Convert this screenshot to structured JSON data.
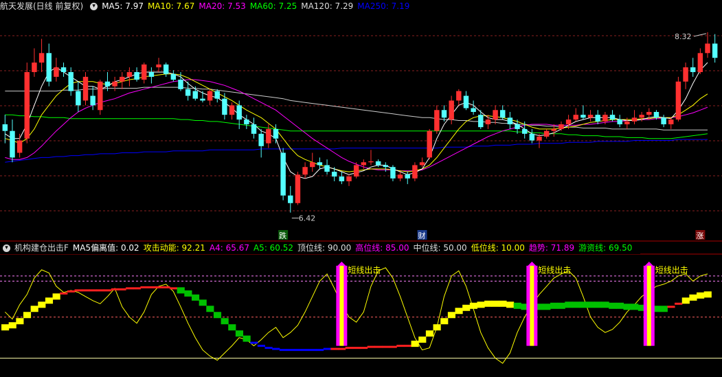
{
  "main_legend": {
    "title": "航天发展(日线 前复权)",
    "items": [
      {
        "label": "MA5: 7.97",
        "color": "#ffffff"
      },
      {
        "label": "MA10: 7.67",
        "color": "#ffff00"
      },
      {
        "label": "MA20: 7.53",
        "color": "#ff00ff"
      },
      {
        "label": "MA60: 7.25",
        "color": "#00ff00"
      },
      {
        "label": "MA120: 7.29",
        "color": "#dddddd"
      },
      {
        "label": "MA250: 7.19",
        "color": "#0000ff"
      }
    ]
  },
  "sub_legend": {
    "title": "机构建仓出击F",
    "items": [
      {
        "label": "MA5偏离值: 0.02",
        "color": "#ffffff"
      },
      {
        "label": "攻击动能: 92.21",
        "color": "#ffff00"
      },
      {
        "label": "A4: 65.67",
        "color": "#ff00ff"
      },
      {
        "label": "A5: 60.52",
        "color": "#00ff00"
      },
      {
        "label": "顶位线: 90.00",
        "color": "#dddddd"
      },
      {
        "label": "高位线: 85.00",
        "color": "#ff00ff"
      },
      {
        "label": "中位线: 50.00",
        "color": "#dddddd"
      },
      {
        "label": "低位线: 10.00",
        "color": "#ffff00"
      },
      {
        "label": "趋势: 71.89",
        "color": "#ff00ff"
      },
      {
        "label": "游资线: 69.50",
        "color": "#00ff00"
      }
    ]
  },
  "annotations": {
    "high_price": "8.32",
    "low_price": "6.42",
    "markers": [
      "跌",
      "财",
      "涨"
    ],
    "signal_label": "短线出击"
  },
  "colors": {
    "up": "#ff3030",
    "down": "#54ffff",
    "ma5": "#ffffff",
    "ma10": "#ffff00",
    "ma20": "#ff00ff",
    "ma60": "#00ff00",
    "ma120": "#cccccc",
    "ma250": "#0000ff",
    "grid": "#8a1f1f",
    "divider": "#aa0000"
  },
  "chart_data": {
    "type": "candlestick",
    "ylim": [
      6.2,
      8.5
    ],
    "candles": [
      [
        7.35,
        7.45,
        7.15,
        7.28
      ],
      [
        7.28,
        7.4,
        6.95,
        7.0
      ],
      [
        7.05,
        7.25,
        7.0,
        7.18
      ],
      [
        7.2,
        8.0,
        7.15,
        7.9
      ],
      [
        7.9,
        8.15,
        7.85,
        8.0
      ],
      [
        8.0,
        8.25,
        7.9,
        8.1
      ],
      [
        8.1,
        8.2,
        7.75,
        7.8
      ],
      [
        7.85,
        8.05,
        7.8,
        7.95
      ],
      [
        7.95,
        8.0,
        7.85,
        7.9
      ],
      [
        7.9,
        7.95,
        7.65,
        7.7
      ],
      [
        7.7,
        7.8,
        7.48,
        7.55
      ],
      [
        7.6,
        7.9,
        7.55,
        7.85
      ],
      [
        7.65,
        7.75,
        7.5,
        7.55
      ],
      [
        7.5,
        7.82,
        7.45,
        7.8
      ],
      [
        7.8,
        7.9,
        7.7,
        7.75
      ],
      [
        7.75,
        7.85,
        7.7,
        7.8
      ],
      [
        7.8,
        7.9,
        7.72,
        7.85
      ],
      [
        7.85,
        7.95,
        7.75,
        7.9
      ],
      [
        7.9,
        7.95,
        7.8,
        7.82
      ],
      [
        7.82,
        8.0,
        7.78,
        7.98
      ],
      [
        7.9,
        7.95,
        7.78,
        7.85
      ],
      [
        7.95,
        8.05,
        7.9,
        7.98
      ],
      [
        7.98,
        8.0,
        7.85,
        7.88
      ],
      [
        7.88,
        7.92,
        7.8,
        7.82
      ],
      [
        7.82,
        7.9,
        7.7,
        7.72
      ],
      [
        7.72,
        7.8,
        7.6,
        7.65
      ],
      [
        7.7,
        7.75,
        7.6,
        7.62
      ],
      [
        7.62,
        7.7,
        7.58,
        7.6
      ],
      [
        7.6,
        7.72,
        7.55,
        7.7
      ],
      [
        7.7,
        7.72,
        7.58,
        7.62
      ],
      [
        7.62,
        7.68,
        7.4,
        7.45
      ],
      [
        7.45,
        7.58,
        7.4,
        7.55
      ],
      [
        7.55,
        7.6,
        7.3,
        7.4
      ],
      [
        7.4,
        7.45,
        7.3,
        7.35
      ],
      [
        7.35,
        7.42,
        7.2,
        7.25
      ],
      [
        7.25,
        7.3,
        7.0,
        7.12
      ],
      [
        7.15,
        7.35,
        7.1,
        7.3
      ],
      [
        7.3,
        7.35,
        7.15,
        7.2
      ],
      [
        7.05,
        7.1,
        6.55,
        6.6
      ],
      [
        6.6,
        6.7,
        6.42,
        6.52
      ],
      [
        6.52,
        6.85,
        6.5,
        6.82
      ],
      [
        6.82,
        6.95,
        6.78,
        6.9
      ],
      [
        6.9,
        7.05,
        6.85,
        6.95
      ],
      [
        6.95,
        7.0,
        6.88,
        6.92
      ],
      [
        6.92,
        6.98,
        6.82,
        6.85
      ],
      [
        6.85,
        6.9,
        6.75,
        6.8
      ],
      [
        6.8,
        6.85,
        6.72,
        6.75
      ],
      [
        6.75,
        6.82,
        6.7,
        6.8
      ],
      [
        6.8,
        6.95,
        6.78,
        6.92
      ],
      [
        6.92,
        6.98,
        6.88,
        6.95
      ],
      [
        6.95,
        7.08,
        6.92,
        6.96
      ],
      [
        6.96,
        6.98,
        6.9,
        6.92
      ],
      [
        6.92,
        6.95,
        6.85,
        6.9
      ],
      [
        6.9,
        6.92,
        6.75,
        6.78
      ],
      [
        6.78,
        6.85,
        6.75,
        6.82
      ],
      [
        6.82,
        6.85,
        6.72,
        6.78
      ],
      [
        6.78,
        6.95,
        6.75,
        6.92
      ],
      [
        6.92,
        7.0,
        6.9,
        6.95
      ],
      [
        7.0,
        7.3,
        6.98,
        7.28
      ],
      [
        7.28,
        7.55,
        7.25,
        7.5
      ],
      [
        7.5,
        7.55,
        7.38,
        7.42
      ],
      [
        7.4,
        7.65,
        7.35,
        7.6
      ],
      [
        7.6,
        7.72,
        7.55,
        7.7
      ],
      [
        7.65,
        7.7,
        7.5,
        7.52
      ],
      [
        7.52,
        7.6,
        7.45,
        7.48
      ],
      [
        7.45,
        7.5,
        7.3,
        7.32
      ],
      [
        7.35,
        7.45,
        7.3,
        7.4
      ],
      [
        7.4,
        7.55,
        7.35,
        7.5
      ],
      [
        7.5,
        7.55,
        7.4,
        7.42
      ],
      [
        7.42,
        7.48,
        7.3,
        7.35
      ],
      [
        7.35,
        7.4,
        7.25,
        7.3
      ],
      [
        7.3,
        7.38,
        7.2,
        7.25
      ],
      [
        7.25,
        7.3,
        7.15,
        7.18
      ],
      [
        7.18,
        7.25,
        7.1,
        7.22
      ],
      [
        7.22,
        7.3,
        7.2,
        7.28
      ],
      [
        7.28,
        7.35,
        7.22,
        7.3
      ],
      [
        7.3,
        7.38,
        7.28,
        7.35
      ],
      [
        7.35,
        7.45,
        7.3,
        7.4
      ],
      [
        7.4,
        7.52,
        7.38,
        7.45
      ],
      [
        7.45,
        7.55,
        7.4,
        7.42
      ],
      [
        7.42,
        7.5,
        7.38,
        7.45
      ],
      [
        7.45,
        7.5,
        7.35,
        7.38
      ],
      [
        7.38,
        7.48,
        7.35,
        7.45
      ],
      [
        7.45,
        7.5,
        7.38,
        7.4
      ],
      [
        7.4,
        7.45,
        7.32,
        7.35
      ],
      [
        7.35,
        7.42,
        7.3,
        7.38
      ],
      [
        7.38,
        7.5,
        7.35,
        7.42
      ],
      [
        7.42,
        7.48,
        7.38,
        7.45
      ],
      [
        7.45,
        7.52,
        7.4,
        7.48
      ],
      [
        7.48,
        7.5,
        7.4,
        7.42
      ],
      [
        7.42,
        7.45,
        7.32,
        7.35
      ],
      [
        7.35,
        7.42,
        7.3,
        7.4
      ],
      [
        7.4,
        7.85,
        7.38,
        7.8
      ],
      [
        7.8,
        8.0,
        7.72,
        7.95
      ],
      [
        7.95,
        8.05,
        7.85,
        7.9
      ],
      [
        7.9,
        8.15,
        7.88,
        8.1
      ],
      [
        8.1,
        8.32,
        8.05,
        8.2
      ],
      [
        8.2,
        8.3,
        8.0,
        8.05
      ]
    ],
    "ma5": [
      7.25,
      7.2,
      7.2,
      7.35,
      7.55,
      7.75,
      7.9,
      7.95,
      7.9,
      7.85,
      7.8,
      7.75,
      7.75,
      7.72,
      7.75,
      7.8,
      7.82,
      7.85,
      7.88,
      7.9,
      7.9,
      7.9,
      7.9,
      7.88,
      7.85,
      7.78,
      7.72,
      7.68,
      7.65,
      7.63,
      7.58,
      7.52,
      7.45,
      7.4,
      7.35,
      7.28,
      7.25,
      7.2,
      7.0,
      6.85,
      6.8,
      6.78,
      6.8,
      6.88,
      6.9,
      6.88,
      6.85,
      6.82,
      6.84,
      6.86,
      6.9,
      6.92,
      6.92,
      6.88,
      6.85,
      6.82,
      6.84,
      6.88,
      7.0,
      7.2,
      7.35,
      7.45,
      7.55,
      7.58,
      7.55,
      7.48,
      7.42,
      7.4,
      7.4,
      7.38,
      7.35,
      7.3,
      7.25,
      7.23,
      7.24,
      7.26,
      7.3,
      7.34,
      7.38,
      7.4,
      7.42,
      7.42,
      7.42,
      7.42,
      7.4,
      7.39,
      7.39,
      7.4,
      7.42,
      7.43,
      7.42,
      7.41,
      7.5,
      7.62,
      7.78,
      7.92,
      8.0
    ],
    "ma10": [
      7.2,
      7.18,
      7.15,
      7.2,
      7.3,
      7.45,
      7.55,
      7.65,
      7.72,
      7.78,
      7.8,
      7.8,
      7.8,
      7.78,
      7.77,
      7.78,
      7.8,
      7.82,
      7.83,
      7.85,
      7.86,
      7.87,
      7.88,
      7.88,
      7.87,
      7.84,
      7.8,
      7.76,
      7.72,
      7.68,
      7.64,
      7.6,
      7.55,
      7.5,
      7.46,
      7.42,
      7.36,
      7.3,
      7.2,
      7.1,
      7.02,
      6.98,
      6.95,
      6.92,
      6.9,
      6.88,
      6.86,
      6.85,
      6.86,
      6.87,
      6.88,
      6.88,
      6.88,
      6.87,
      6.86,
      6.85,
      6.86,
      6.88,
      6.92,
      7.0,
      7.1,
      7.2,
      7.3,
      7.38,
      7.42,
      7.44,
      7.44,
      7.43,
      7.42,
      7.4,
      7.38,
      7.35,
      7.32,
      7.3,
      7.3,
      7.3,
      7.31,
      7.32,
      7.33,
      7.35,
      7.37,
      7.38,
      7.39,
      7.4,
      7.4,
      7.4,
      7.4,
      7.41,
      7.41,
      7.42,
      7.42,
      7.42,
      7.45,
      7.5,
      7.55,
      7.62,
      7.67
    ],
    "ma20": [
      7.0,
      6.98,
      6.98,
      7.0,
      7.05,
      7.12,
      7.2,
      7.28,
      7.35,
      7.42,
      7.48,
      7.52,
      7.55,
      7.58,
      7.6,
      7.62,
      7.65,
      7.68,
      7.7,
      7.72,
      7.74,
      7.76,
      7.78,
      7.8,
      7.81,
      7.82,
      7.82,
      7.81,
      7.8,
      7.78,
      7.76,
      7.73,
      7.7,
      7.66,
      7.62,
      7.58,
      7.54,
      7.5,
      7.44,
      7.38,
      7.32,
      7.26,
      7.2,
      7.15,
      7.1,
      7.05,
      7.0,
      6.96,
      6.93,
      6.9,
      6.88,
      6.87,
      6.87,
      6.87,
      6.86,
      6.86,
      6.86,
      6.87,
      6.9,
      6.94,
      6.98,
      7.02,
      7.06,
      7.1,
      7.14,
      7.18,
      7.22,
      7.25,
      7.28,
      7.3,
      7.32,
      7.34,
      7.35,
      7.35,
      7.35,
      7.34,
      7.34,
      7.34,
      7.34,
      7.35,
      7.35,
      7.36,
      7.37,
      7.38,
      7.38,
      7.39,
      7.39,
      7.4,
      7.4,
      7.41,
      7.41,
      7.42,
      7.43,
      7.45,
      7.47,
      7.5,
      7.53
    ],
    "ma60": [
      7.45,
      7.45,
      7.44,
      7.44,
      7.43,
      7.43,
      7.42,
      7.42,
      7.42,
      7.41,
      7.41,
      7.41,
      7.41,
      7.41,
      7.41,
      7.41,
      7.41,
      7.41,
      7.41,
      7.41,
      7.41,
      7.41,
      7.41,
      7.41,
      7.4,
      7.4,
      7.39,
      7.39,
      7.38,
      7.38,
      7.37,
      7.36,
      7.35,
      7.34,
      7.33,
      7.32,
      7.31,
      7.3,
      7.29,
      7.28,
      7.28,
      7.28,
      7.28,
      7.28,
      7.28,
      7.28,
      7.28,
      7.28,
      7.28,
      7.28,
      7.28,
      7.28,
      7.28,
      7.28,
      7.28,
      7.28,
      7.28,
      7.28,
      7.28,
      7.28,
      7.28,
      7.28,
      7.28,
      7.28,
      7.28,
      7.28,
      7.28,
      7.28,
      7.28,
      7.28,
      7.27,
      7.27,
      7.26,
      7.26,
      7.25,
      7.25,
      7.25,
      7.24,
      7.24,
      7.23,
      7.23,
      7.23,
      7.22,
      7.22,
      7.22,
      7.21,
      7.21,
      7.21,
      7.2,
      7.2,
      7.2,
      7.2,
      7.21,
      7.22,
      7.23,
      7.24,
      7.25
    ],
    "ma120": [
      7.7,
      7.7,
      7.7,
      7.7,
      7.7,
      7.7,
      7.7,
      7.7,
      7.71,
      7.71,
      7.71,
      7.72,
      7.72,
      7.72,
      7.73,
      7.73,
      7.73,
      7.73,
      7.73,
      7.74,
      7.74,
      7.74,
      7.74,
      7.74,
      7.74,
      7.73,
      7.73,
      7.72,
      7.72,
      7.71,
      7.7,
      7.69,
      7.68,
      7.67,
      7.66,
      7.65,
      7.64,
      7.63,
      7.62,
      7.6,
      7.59,
      7.58,
      7.57,
      7.56,
      7.55,
      7.54,
      7.53,
      7.52,
      7.51,
      7.5,
      7.49,
      7.48,
      7.47,
      7.46,
      7.45,
      7.44,
      7.43,
      7.42,
      7.42,
      7.41,
      7.4,
      7.4,
      7.39,
      7.39,
      7.38,
      7.38,
      7.37,
      7.37,
      7.36,
      7.36,
      7.35,
      7.35,
      7.34,
      7.34,
      7.33,
      7.33,
      7.32,
      7.32,
      7.32,
      7.31,
      7.31,
      7.31,
      7.31,
      7.3,
      7.3,
      7.3,
      7.3,
      7.3,
      7.3,
      7.3,
      7.29,
      7.29,
      7.29,
      7.29,
      7.29,
      7.29,
      7.29
    ],
    "ma250": [
      6.95,
      6.96,
      6.97,
      6.98,
      6.99,
      7.0,
      7.0,
      7.01,
      7.01,
      7.02,
      7.02,
      7.03,
      7.03,
      7.04,
      7.04,
      7.04,
      7.05,
      7.05,
      7.05,
      7.06,
      7.06,
      7.06,
      7.06,
      7.07,
      7.07,
      7.07,
      7.07,
      7.07,
      7.08,
      7.08,
      7.08,
      7.08,
      7.08,
      7.08,
      7.08,
      7.09,
      7.09,
      7.09,
      7.09,
      7.09,
      7.09,
      7.09,
      7.09,
      7.09,
      7.09,
      7.09,
      7.1,
      7.1,
      7.1,
      7.1,
      7.1,
      7.1,
      7.1,
      7.1,
      7.1,
      7.1,
      7.1,
      7.1,
      7.1,
      7.1,
      7.11,
      7.11,
      7.11,
      7.11,
      7.12,
      7.12,
      7.12,
      7.13,
      7.13,
      7.13,
      7.14,
      7.14,
      7.14,
      7.15,
      7.15,
      7.15,
      7.15,
      7.16,
      7.16,
      7.16,
      7.16,
      7.17,
      7.17,
      7.17,
      7.17,
      7.17,
      7.18,
      7.18,
      7.18,
      7.18,
      7.18,
      7.18,
      7.19,
      7.19,
      7.19,
      7.19,
      7.19
    ],
    "indicator": {
      "ylim": [
        -5,
        110
      ],
      "levels": [
        90,
        85,
        50,
        10
      ],
      "trend": [
        40,
        42,
        46,
        52,
        58,
        62,
        66,
        70,
        73,
        75,
        76,
        76,
        76,
        76,
        76,
        77,
        77,
        78,
        78,
        79,
        79,
        79,
        79,
        78,
        76,
        73,
        69,
        64,
        58,
        52,
        46,
        40,
        34,
        29,
        25,
        22,
        20,
        19,
        18,
        18,
        18,
        18,
        18,
        18,
        19,
        19,
        19,
        20,
        20,
        20,
        21,
        21,
        21,
        21,
        22,
        22,
        24,
        28,
        34,
        40,
        46,
        52,
        56,
        59,
        61,
        62,
        63,
        63,
        63,
        62,
        61,
        60,
        60,
        60,
        60,
        61,
        61,
        62,
        62,
        62,
        62,
        62,
        62,
        61,
        61,
        60,
        60,
        59,
        59,
        58,
        58,
        60,
        63,
        66,
        69,
        71,
        72
      ],
      "color_state": [
        1,
        1,
        1,
        1,
        1,
        1,
        1,
        1,
        0,
        0,
        0,
        0,
        0,
        0,
        0,
        0,
        0,
        0,
        0,
        0,
        0,
        0,
        0,
        0,
        2,
        2,
        2,
        2,
        2,
        2,
        2,
        2,
        2,
        2,
        3,
        3,
        3,
        3,
        3,
        3,
        3,
        3,
        3,
        3,
        3,
        0,
        0,
        0,
        0,
        0,
        0,
        0,
        0,
        0,
        0,
        0,
        1,
        1,
        1,
        1,
        1,
        1,
        1,
        1,
        1,
        1,
        1,
        1,
        1,
        1,
        2,
        2,
        2,
        2,
        2,
        2,
        2,
        2,
        2,
        2,
        2,
        2,
        2,
        2,
        2,
        2,
        2,
        2,
        2,
        2,
        2,
        0,
        0,
        1,
        1,
        1,
        1
      ],
      "momentum": [
        55,
        48,
        62,
        72,
        88,
        96,
        93,
        80,
        74,
        76,
        74,
        70,
        66,
        63,
        70,
        78,
        60,
        50,
        44,
        55,
        72,
        80,
        82,
        75,
        60,
        44,
        30,
        18,
        12,
        8,
        15,
        22,
        30,
        28,
        22,
        28,
        35,
        40,
        30,
        35,
        42,
        55,
        70,
        85,
        92,
        78,
        62,
        50,
        45,
        55,
        80,
        95,
        98,
        88,
        70,
        50,
        30,
        18,
        20,
        40,
        70,
        90,
        95,
        80,
        58,
        35,
        20,
        10,
        5,
        15,
        35,
        50,
        62,
        72,
        80,
        88,
        92,
        95,
        88,
        70,
        50,
        40,
        35,
        38,
        45,
        55,
        62,
        70,
        75,
        80,
        82,
        85,
        90,
        92,
        85,
        90,
        92
      ],
      "signals": [
        46,
        72,
        88
      ]
    }
  }
}
